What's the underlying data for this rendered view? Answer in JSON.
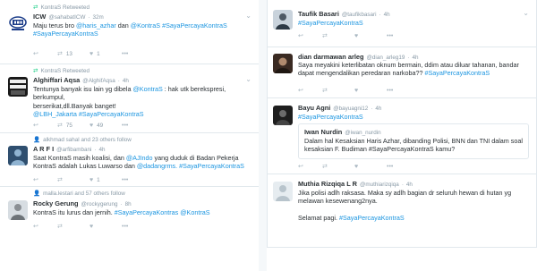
{
  "left": {
    "t1": {
      "context": "KontraS Retweeted",
      "name": "ICW",
      "handle": "@sahabatICW",
      "time": "32m",
      "line1_a": "Maju terus bro ",
      "line1_mention1": "@haris_azhar",
      "line1_b": " dan ",
      "line1_mention2": "@KontraS",
      "line1_hashtag": " #SayaPercayaKontraS",
      "line2_hashtag": "#SayaPercayaKontraS",
      "retweets": "13",
      "likes": "1"
    },
    "t2": {
      "context": "KontraS Retweeted",
      "name": "Alghiffari Aqsa",
      "handle": "@AlghifAqsa",
      "time": "4h",
      "line1_a": "Tentunya banyak isu lain yg dibela ",
      "line1_mention": "@KontraS",
      "line2": "berserikat,dll.Banyak banget!",
      "line3_mention": "@LBH_Jakarta",
      "line3_hashtag": " #SayaPercayaKontraS",
      "line1_b": " : hak utk berekspresi, berkumpul,",
      "retweets": "75",
      "likes": "49"
    },
    "t3": {
      "context": "alkhmad sahal and 23 others follow",
      "name": "A R F I",
      "handle": "@arfibambani",
      "time": "4h",
      "line1_a": "Saat KontraS masih koalisi, dan ",
      "line1_mention": "@AJIndo",
      "line1_b": " yang duduk di Badan Pekerja",
      "line2_a": "KontraS adalah Lukas Luwarso dan ",
      "line2_mention": "@dadangrms",
      "line2_hashtag": ". #SayaPercayaKontraS",
      "likes": "1"
    },
    "t4": {
      "context": "malla.lestari and 57 others follow",
      "name": "Rocky Gerung",
      "handle": "@rockygerung",
      "time": "8h",
      "line1_a": "KontraS itu lurus dan jernih. ",
      "line1_hashtag": "#SayaPercayaKontras",
      "line1_mention": " @KontraS"
    }
  },
  "right": {
    "t1": {
      "name": "Taufik Basari",
      "handle": "@taufikbasari",
      "time": "4h",
      "hashtag": "#SayaPercayaKontraS"
    },
    "t2": {
      "name": "dian darmawan arleg",
      "handle": "@dian_arleg19",
      "time": "4h",
      "line1": "Saya meyakini keterlibatan oknum bermain, ddim atau diluar tahanan, bandar",
      "line2": "dapat mengendalikan peredaran narkoba?? ",
      "hashtag": "#SayaPercayaKontraS"
    },
    "t3": {
      "name": "Bayu Agni",
      "handle": "@bayuagni12",
      "time": "4h",
      "hashtag": "#SayaPercayaKontraS",
      "quote": {
        "name": "Iwan Nurdin",
        "handle": "@iwan_nurdin",
        "line1": "Dalam hal Kesaksian Haris Azhar, dibanding Polisi, BNN dan TNI dalam soal",
        "line2": "kesaksian F. Budiman #SayaPercayaKontraS kamu?"
      }
    },
    "t4": {
      "name": "Muthia Rizqiqa L R",
      "handle": "@muthiarizqiqa",
      "time": "4h",
      "line1": "Jika polisi adlh raksasa. Maka sy adlh bagian dr seluruh hewan di hutan yg",
      "line2": "melawan kesewenang2nya.",
      "line3": "Selamat pagi. ",
      "hashtag": "#SayaPercayaKontraS"
    }
  },
  "icons": {
    "reply": "reply-icon",
    "retweet": "retweet-icon",
    "like": "heart-icon",
    "more": "more-icon",
    "chevron": "chevron-down-icon"
  },
  "colors": {
    "link": "#1b95e0",
    "muted": "#8899a6",
    "retweet": "#19cf86",
    "text": "#292f33"
  }
}
